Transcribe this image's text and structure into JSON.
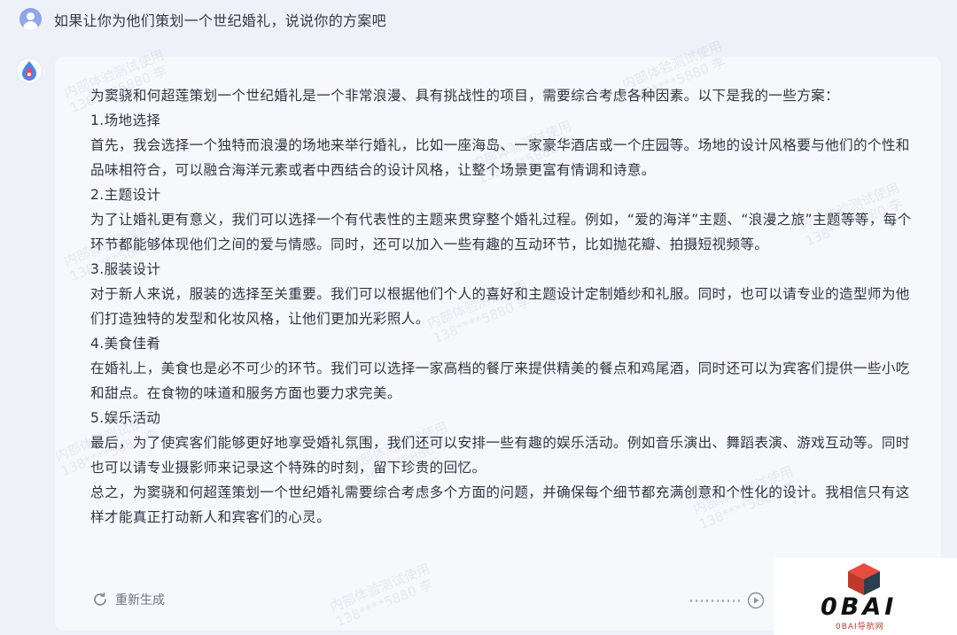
{
  "user": {
    "question": "如果让你为他们策划一个世纪婚礼，说说你的方案吧"
  },
  "answer": {
    "paragraphs": [
      "为窦骁和何超莲策划一个世纪婚礼是一个非常浪漫、具有挑战性的项目，需要综合考虑各种因素。以下是我的一些方案：",
      "1.场地选择",
      "首先，我会选择一个独特而浪漫的场地来举行婚礼，比如一座海岛、一家豪华酒店或一个庄园等。场地的设计风格要与他们的个性和品味相符合，可以融合海洋元素或者中西结合的设计风格，让整个场景更富有情调和诗意。",
      "2.主题设计",
      "为了让婚礼更有意义，我们可以选择一个有代表性的主题来贯穿整个婚礼过程。例如，“爱的海洋”主题、“浪漫之旅”主题等等，每个环节都能够体现他们之间的爱与情感。同时，还可以加入一些有趣的互动环节，比如抛花瓣、拍摄短视频等。",
      "3.服装设计",
      "对于新人来说，服装的选择至关重要。我们可以根据他们个人的喜好和主题设计定制婚纱和礼服。同时，也可以请专业的造型师为他们打造独特的发型和化妆风格，让他们更加光彩照人。",
      "4.美食佳肴",
      "在婚礼上，美食也是必不可少的环节。我们可以选择一家高档的餐厅来提供精美的餐点和鸡尾酒，同时还可以为宾客们提供一些小吃和甜点。在食物的味道和服务方面也要力求完美。",
      "5.娱乐活动",
      "最后，为了使宾客们能够更好地享受婚礼氛围，我们还可以安排一些有趣的娱乐活动。例如音乐演出、舞蹈表演、游戏互动等。同时也可以请专业摄影师来记录这个特殊的时刻，留下珍贵的回忆。",
      "总之，为窦骁和何超莲策划一个世纪婚礼需要综合考虑多个方面的问题，并确保每个细节都充满创意和个性化的设计。我相信只有这样才能真正打动新人和宾客们的心灵。"
    ]
  },
  "footer": {
    "regenerate_label": "重新生成"
  },
  "watermark": {
    "line1": "内部体验测试使用",
    "line2": "138****5880 李"
  },
  "logo": {
    "text": "0BAI",
    "subtext": "0BAI导航网"
  },
  "icons": {
    "user_avatar": "user-icon",
    "bot_avatar": "bot-logo-icon",
    "regenerate": "refresh-icon",
    "play": "play-circle-icon",
    "logo_cube": "cube-icon"
  },
  "colors": {
    "page_bg": "#eef1f7",
    "card_bg": "#f6f8fc",
    "text": "#2f3542",
    "logo_red": "#d63031"
  }
}
